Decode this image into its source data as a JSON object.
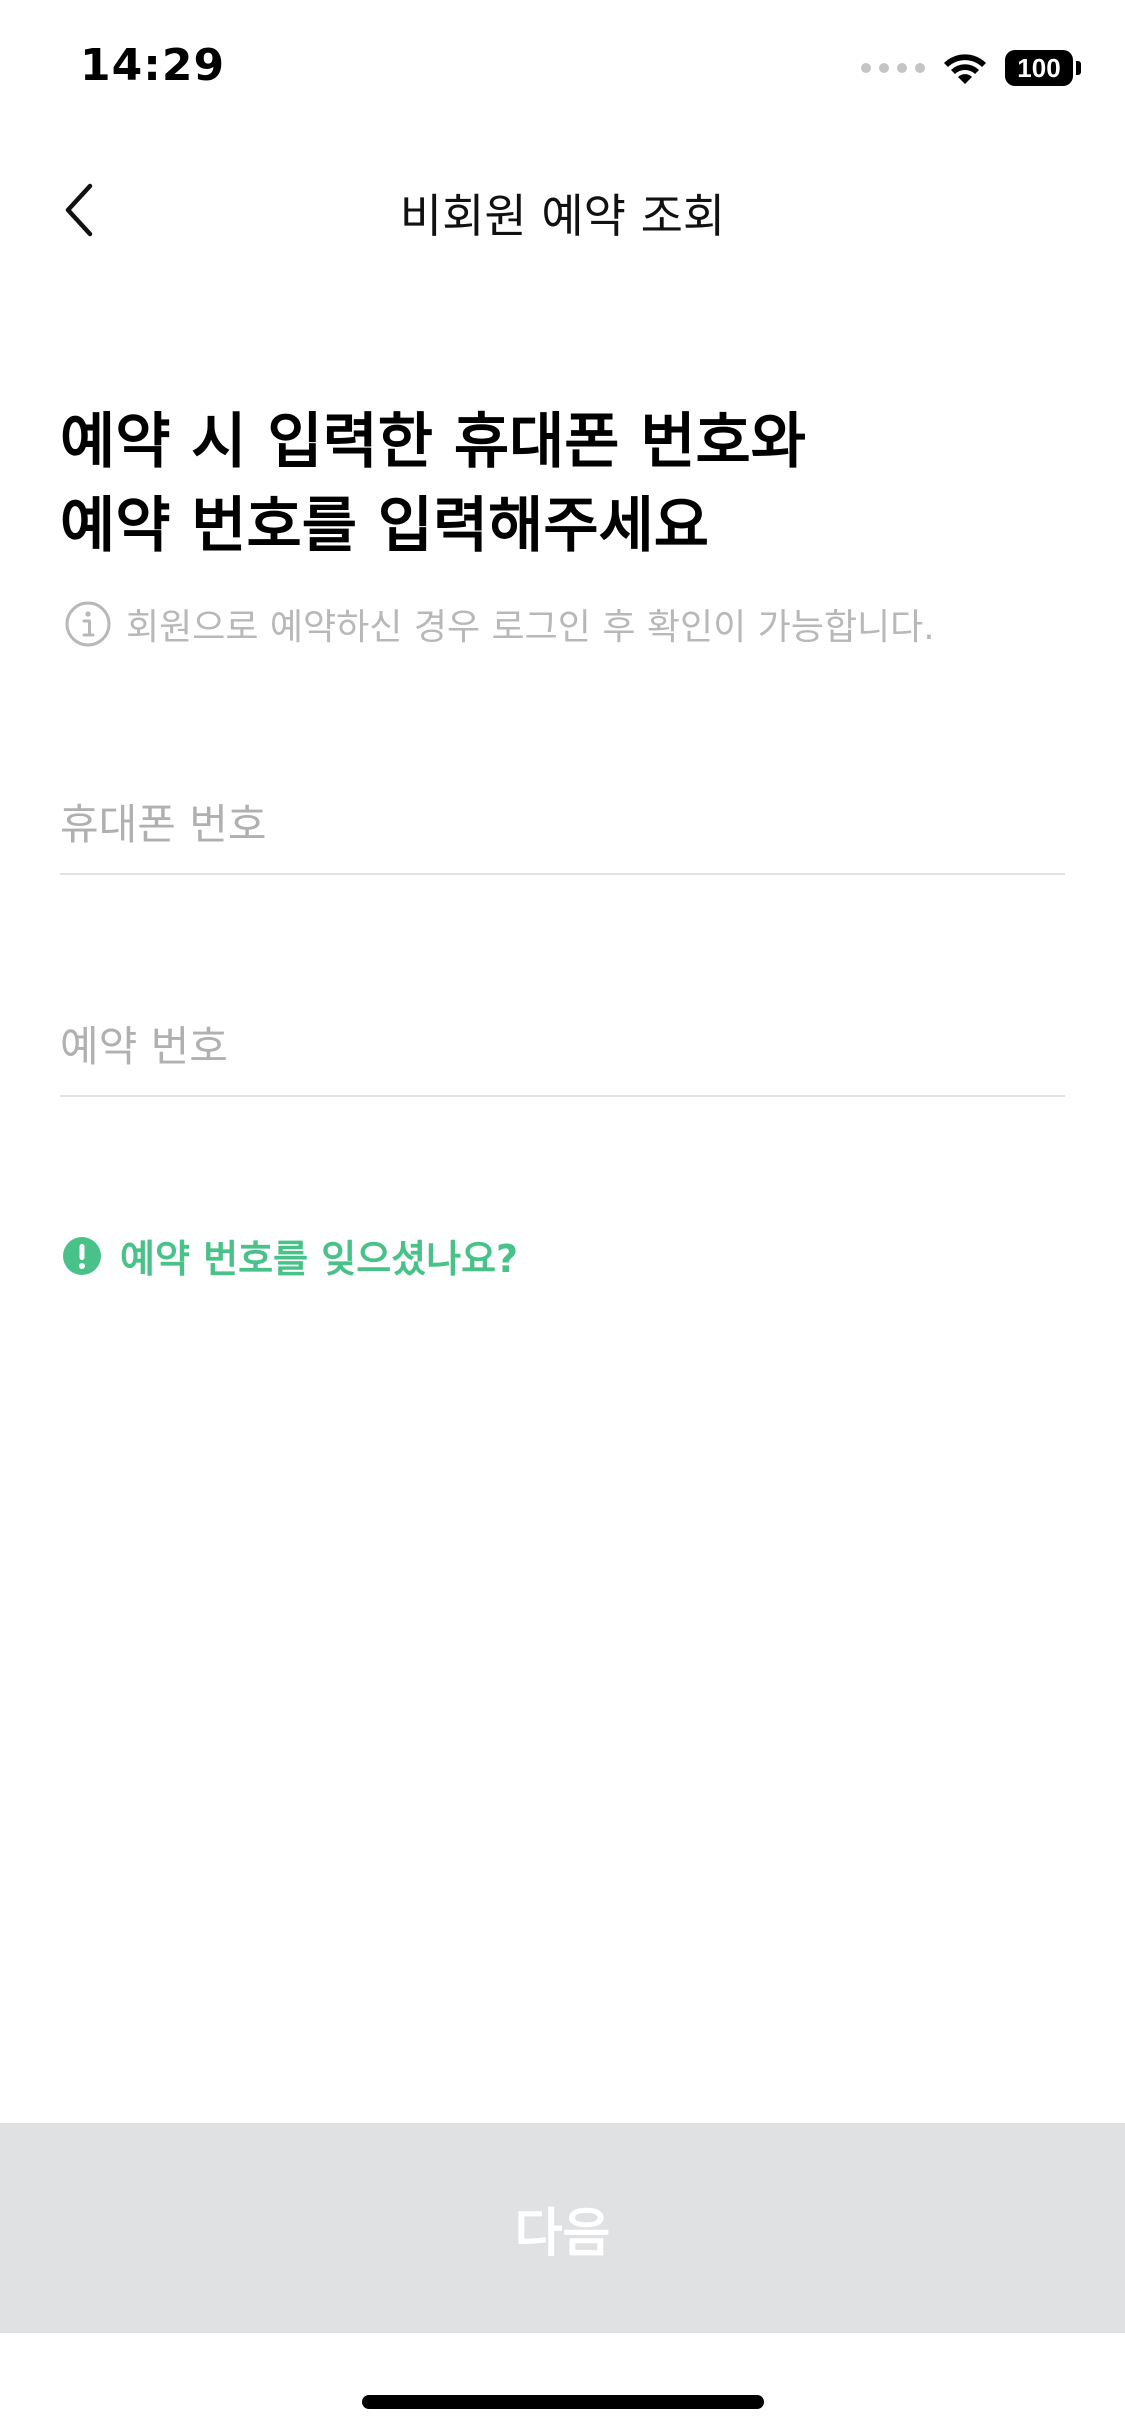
{
  "status_bar": {
    "time": "14:29",
    "battery": "100"
  },
  "nav": {
    "title": "비회원 예약 조회",
    "back_icon": "chevron-left-icon"
  },
  "heading": {
    "line1": "예약 시 입력한 휴대폰 번호와",
    "line2": "예약 번호를 입력해주세요"
  },
  "info": {
    "icon": "info-icon",
    "text": "회원으로 예약하신 경우 로그인 후 확인이 가능합니다."
  },
  "form": {
    "phone": {
      "value": "",
      "placeholder": "휴대폰 번호"
    },
    "reservation": {
      "value": "",
      "placeholder": "예약 번호"
    }
  },
  "forgot": {
    "icon": "alert-icon",
    "label": "예약 번호를 잊으셨나요?"
  },
  "next_button": {
    "label": "다음"
  },
  "colors": {
    "accent": "#49c289",
    "disabled_button": "#dfe1e2",
    "placeholder": "#b0b0b0",
    "divider": "#e3e3e3"
  }
}
